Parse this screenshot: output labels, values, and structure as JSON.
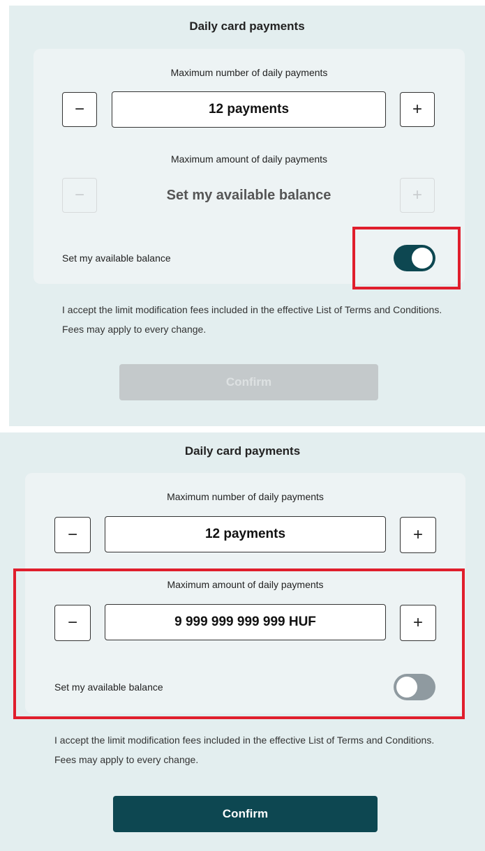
{
  "colors": {
    "panel_bg": "#e3eeef",
    "card_bg": "#edf3f4",
    "accent": "#0d4751",
    "highlight": "#e01e2c",
    "disabled_button": "#c4c9cb"
  },
  "screens": [
    {
      "title": "Daily card payments",
      "count": {
        "label": "Maximum number of daily payments",
        "value": "12 payments",
        "minus": "−",
        "plus": "+"
      },
      "amount": {
        "label": "Maximum amount of daily payments",
        "value": "Set my available balance",
        "minus": "−",
        "plus": "+",
        "disabled": true
      },
      "toggle": {
        "label": "Set my available balance",
        "state": "on"
      },
      "fees_text": "I accept the limit modification fees included in the effective List of Terms and Conditions. Fees may apply to every change.",
      "confirm": {
        "label": "Confirm",
        "enabled": false
      }
    },
    {
      "title": "Daily card payments",
      "count": {
        "label": "Maximum number of daily payments",
        "value": "12 payments",
        "minus": "−",
        "plus": "+"
      },
      "amount": {
        "label": "Maximum amount of daily payments",
        "value": "9 999 999 999 999 HUF",
        "minus": "−",
        "plus": "+",
        "disabled": false
      },
      "toggle": {
        "label": "Set my available balance",
        "state": "off"
      },
      "fees_text": "I accept the limit modification fees included in the effective List of Terms and Conditions. Fees may apply to every change.",
      "confirm": {
        "label": "Confirm",
        "enabled": true
      }
    }
  ]
}
